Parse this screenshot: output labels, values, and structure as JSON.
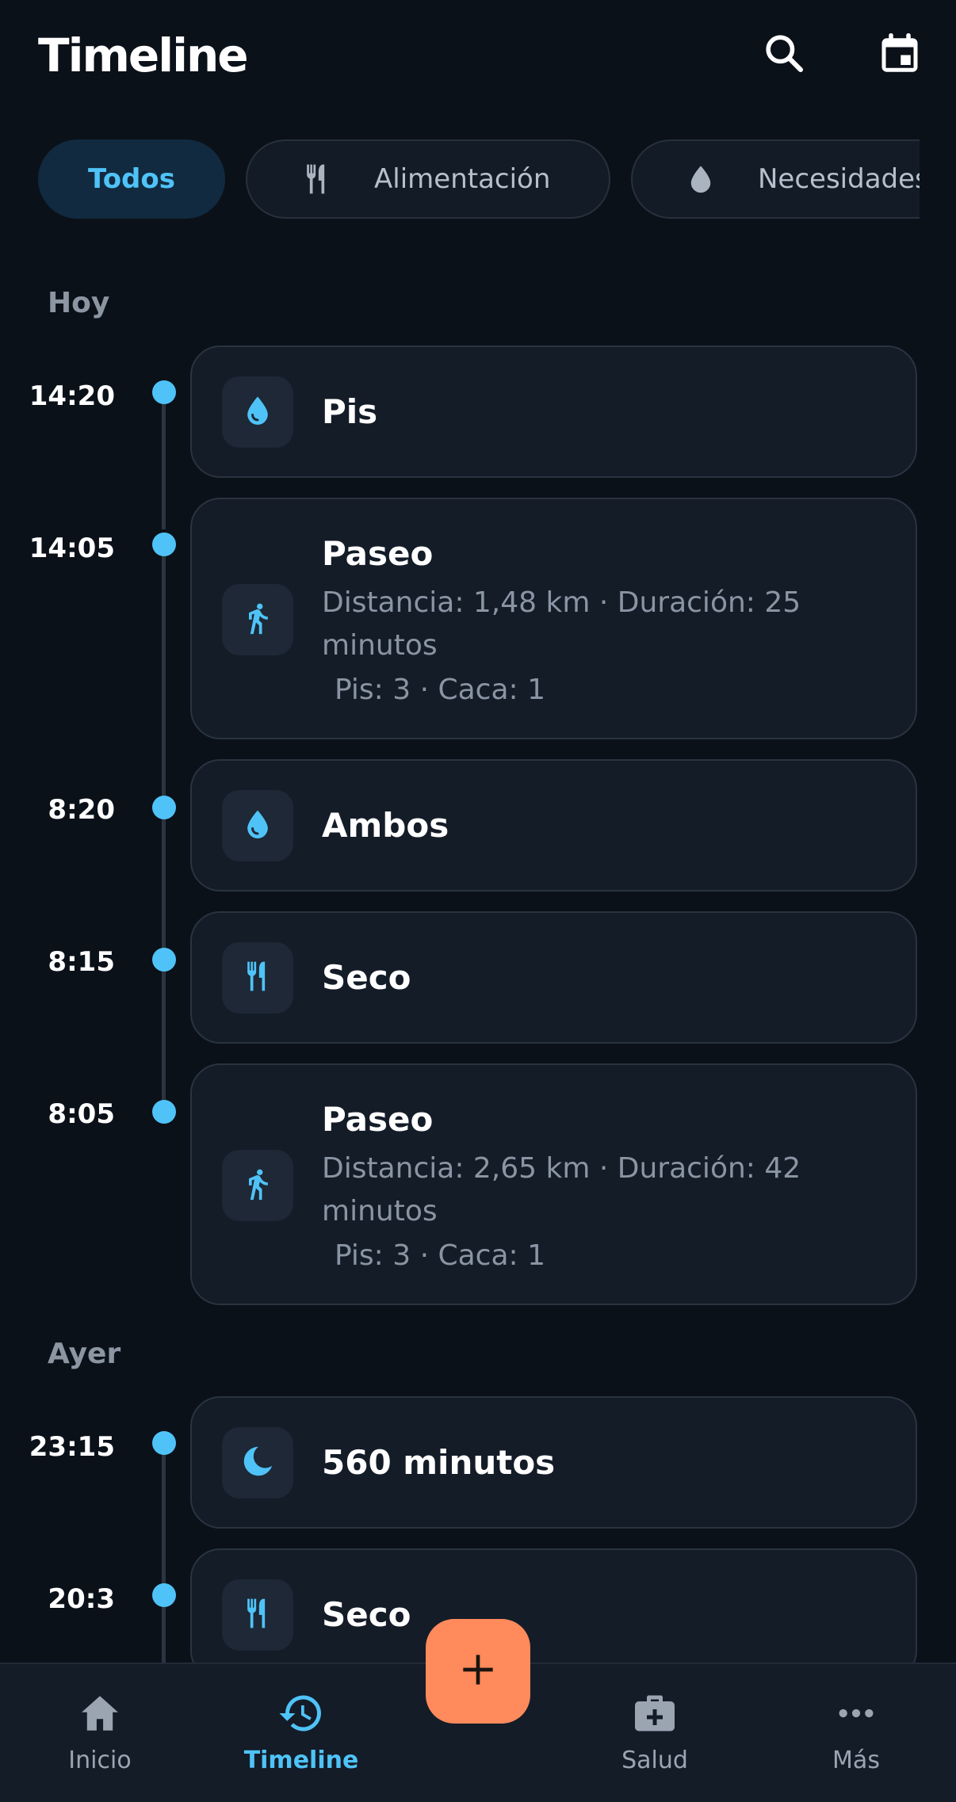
{
  "header": {
    "title": "Timeline",
    "search_icon": "search-icon",
    "calendar_icon": "calendar-icon"
  },
  "filters": [
    {
      "label": "Todos",
      "active": true
    },
    {
      "label": "Alimentación",
      "icon": "fork-knife-icon"
    },
    {
      "label": "Necesidades",
      "icon": "drop-icon"
    }
  ],
  "sections": [
    {
      "label": "Hoy",
      "events": [
        {
          "time": "14:20",
          "icon": "drop-icon",
          "title": "Pis"
        },
        {
          "time": "14:05",
          "icon": "walk-icon",
          "title": "Paseo",
          "details": "Distancia: 1,48 km · Duración: 25 minutos",
          "details2": "Pis: 3 · Caca: 1"
        },
        {
          "time": "8:20",
          "icon": "drop-icon",
          "title": "Ambos"
        },
        {
          "time": "8:15",
          "icon": "fork-knife-icon",
          "title": "Seco"
        },
        {
          "time": "8:05",
          "icon": "walk-icon",
          "title": "Paseo",
          "details": "Distancia: 2,65 km · Duración: 42 minutos",
          "details2": "Pis: 3 · Caca: 1"
        }
      ]
    },
    {
      "label": "Ayer",
      "events": [
        {
          "time": "23:15",
          "icon": "moon-icon",
          "title": "560 minutos"
        },
        {
          "time": "20:3",
          "icon": "fork-knife-icon",
          "title": "Seco"
        }
      ]
    }
  ],
  "bottom_nav": [
    {
      "label": "Inicio",
      "icon": "home-icon"
    },
    {
      "label": "Timeline",
      "icon": "history-icon",
      "active": true
    },
    {
      "label": "Salud",
      "icon": "medical-kit-icon"
    },
    {
      "label": "Más",
      "icon": "more-icon"
    }
  ],
  "fab": {
    "icon": "plus-icon"
  },
  "colors": {
    "accent": "#4fc3f7",
    "fab": "#ff8a5c",
    "background": "#0b1119",
    "card": "#141c28"
  }
}
